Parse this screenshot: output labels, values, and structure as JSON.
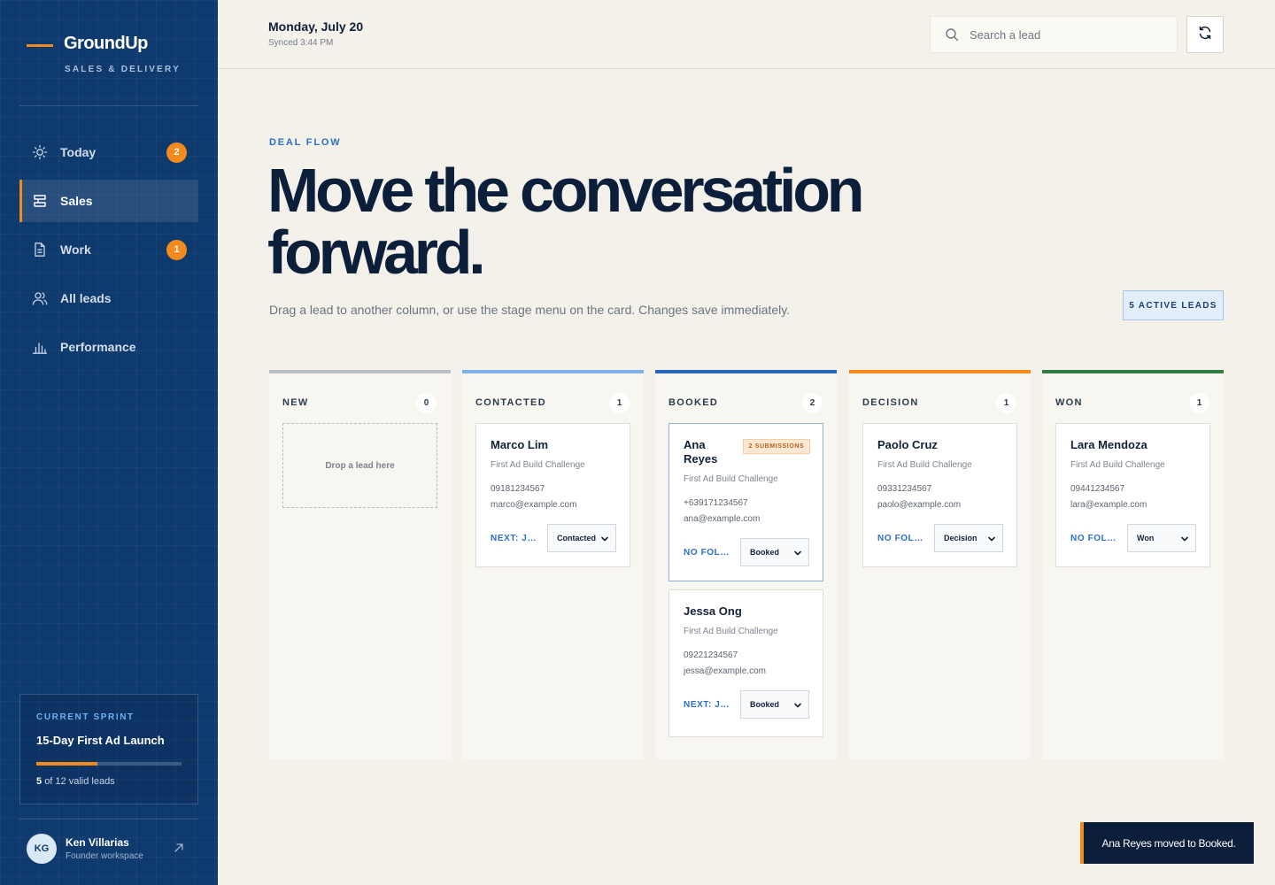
{
  "brand": {
    "name": "GroundUp",
    "subtitle": "SALES & DELIVERY"
  },
  "sidebar": {
    "items": [
      {
        "label": "Today",
        "icon": "sun-icon",
        "badge": "2",
        "active": false
      },
      {
        "label": "Sales",
        "icon": "pipeline-icon",
        "badge": "",
        "active": true
      },
      {
        "label": "Work",
        "icon": "document-icon",
        "badge": "1",
        "active": false
      },
      {
        "label": "All leads",
        "icon": "users-icon",
        "badge": "",
        "active": false
      },
      {
        "label": "Performance",
        "icon": "bar-chart-icon",
        "badge": "",
        "active": false
      }
    ],
    "sprint": {
      "tag": "CURRENT SPRINT",
      "title": "15-Day First Ad Launch",
      "current": "5",
      "suffix": "of 12 valid leads",
      "progress": 0.42
    },
    "user": {
      "initials": "KG",
      "name": "Ken Villarias",
      "role": "Founder workspace"
    }
  },
  "header": {
    "date": "Monday, July 20",
    "synced": "Synced 3:44 PM",
    "search_placeholder": "Search a lead"
  },
  "hero": {
    "eyebrow": "DEAL FLOW",
    "headline": "Move the conversation forward.",
    "subline": "Drag a lead to another column, or use the stage menu on the card. Changes save immediately.",
    "active_leads": "5 ACTIVE LEADS"
  },
  "columns": [
    {
      "title": "NEW",
      "count": "0",
      "color": "#b9bec5",
      "empty_text": "Drop a lead here"
    },
    {
      "title": "CONTACTED",
      "count": "1",
      "color": "#7fb0e6"
    },
    {
      "title": "BOOKED",
      "count": "2",
      "color": "#2a66bb"
    },
    {
      "title": "DECISION",
      "count": "1",
      "color": "#f28a1d"
    },
    {
      "title": "WON",
      "count": "1",
      "color": "#2e7d46"
    }
  ],
  "cards": {
    "marco": {
      "name": "Marco Lim",
      "program": "First Ad Build Challenge",
      "phone": "09181234567",
      "email": "marco@example.com",
      "next": "NEXT: JU...",
      "stage": "Contacted"
    },
    "ana": {
      "name": "Ana Reyes",
      "badge": "2 SUBMISSIONS",
      "program": "First Ad Build Challenge",
      "phone": "+639171234567",
      "email": "ana@example.com",
      "next": "NO FOLLO...",
      "stage": "Booked"
    },
    "jessa": {
      "name": "Jessa Ong",
      "program": "First Ad Build Challenge",
      "phone": "09221234567",
      "email": "jessa@example.com",
      "next": "NEXT: JU...",
      "stage": "Booked"
    },
    "paolo": {
      "name": "Paolo Cruz",
      "program": "First Ad Build Challenge",
      "phone": "09331234567",
      "email": "paolo@example.com",
      "next": "NO FOLLO...",
      "stage": "Decision"
    },
    "lara": {
      "name": "Lara Mendoza",
      "program": "First Ad Build Challenge",
      "phone": "09441234567",
      "email": "lara@example.com",
      "next": "NO FOLLO...",
      "stage": "Won"
    }
  },
  "toast": {
    "message": "Ana Reyes moved to Booked."
  },
  "colors": {
    "accent": "#f28a1d",
    "sidebar": "#0f3a6e",
    "link": "#2c6fc9",
    "ink": "#0b1f3b"
  }
}
